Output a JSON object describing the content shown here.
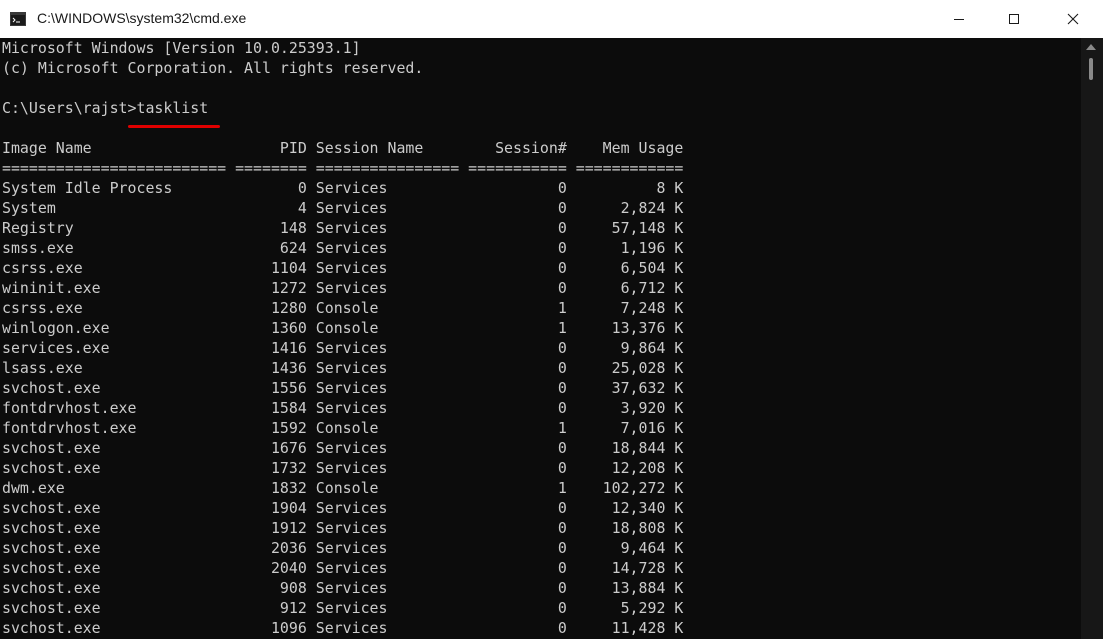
{
  "window": {
    "title": "C:\\WINDOWS\\system32\\cmd.exe",
    "app_icon": "cmd-icon",
    "controls": [
      "minimize-icon",
      "maximize-icon",
      "close-icon"
    ]
  },
  "console": {
    "lines": [
      "Microsoft Windows [Version 10.0.25393.1]",
      "(c) Microsoft Corporation. All rights reserved.",
      "",
      "C:\\Users\\rajst>tasklist",
      "",
      "Image Name                     PID Session Name        Session#    Mem Usage",
      "========================= ======== ================ =========== ============",
      "System Idle Process              0 Services                   0          8 K",
      "System                           4 Services                   0      2,824 K",
      "Registry                       148 Services                   0     57,148 K",
      "smss.exe                       624 Services                   0      1,196 K",
      "csrss.exe                     1104 Services                   0      6,504 K",
      "wininit.exe                   1272 Services                   0      6,712 K",
      "csrss.exe                     1280 Console                    1      7,248 K",
      "winlogon.exe                  1360 Console                    1     13,376 K",
      "services.exe                  1416 Services                   0      9,864 K",
      "lsass.exe                     1436 Services                   0     25,028 K",
      "svchost.exe                   1556 Services                   0     37,632 K",
      "fontdrvhost.exe               1584 Services                   0      3,920 K",
      "fontdrvhost.exe               1592 Console                    1      7,016 K",
      "svchost.exe                   1676 Services                   0     18,844 K",
      "svchost.exe                   1732 Services                   0     12,208 K",
      "dwm.exe                       1832 Console                    1    102,272 K",
      "svchost.exe                   1904 Services                   0     12,340 K",
      "svchost.exe                   1912 Services                   0     18,808 K",
      "svchost.exe                   2036 Services                   0      9,464 K",
      "svchost.exe                   2040 Services                   0     14,728 K",
      "svchost.exe                    908 Services                   0     13,884 K",
      "svchost.exe                    912 Services                   0      5,292 K",
      "svchost.exe                   1096 Services                   0     11,428 K"
    ]
  },
  "colors": {
    "console_bg": "#0c0c0c",
    "console_text": "#cccccc",
    "annotation_underline": "#e00000",
    "titlebar_bg": "#ffffff"
  }
}
